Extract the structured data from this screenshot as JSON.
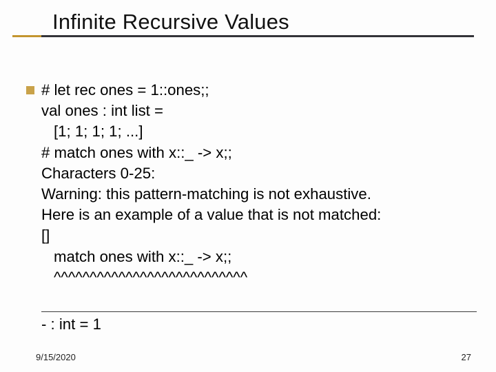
{
  "title": "Infinite Recursive Values",
  "body": {
    "l1": "# let rec ones = 1::ones;;",
    "l2": "val ones : int list =",
    "l3": "[1; 1; 1; 1; ...]",
    "l4": "# match ones with x::_ -> x;;",
    "l5": "Characters 0-25:",
    "l6": "Warning: this pattern-matching is not exhaustive.",
    "l7": "Here is an example of a value that is not matched:",
    "l8": "[]",
    "l9": "match ones with x::_ -> x;;",
    "l10": "^^^^^^^^^^^^^^^^^^^^^^^^^^^",
    "result": "- : int = 1"
  },
  "footer": {
    "date": "9/15/2020",
    "page": "27"
  }
}
